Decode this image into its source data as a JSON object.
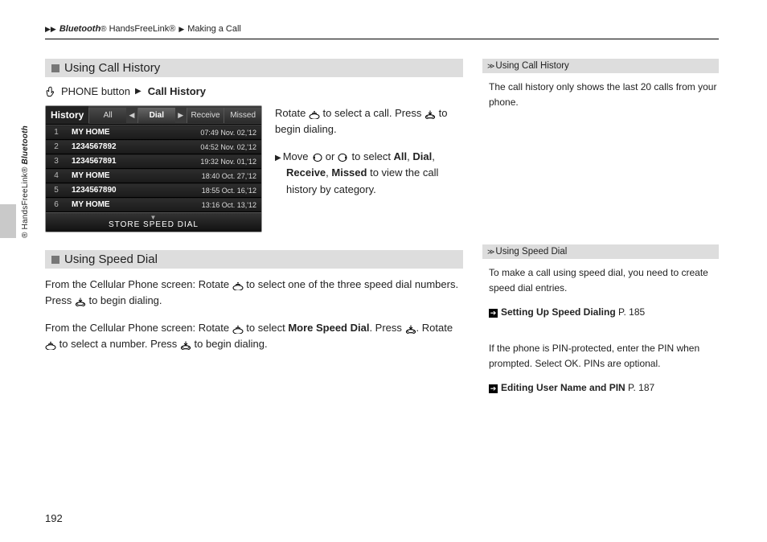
{
  "breadcrumb": {
    "seg1": "Bluetooth",
    "seg1reg": "®",
    "seg2": " HandsFreeLink®",
    "seg3": "Making a Call"
  },
  "side_vertical": {
    "t1": "Bluetooth",
    "t2": "® HandsFreeLink®"
  },
  "page_number": "192",
  "section1": {
    "title": "Using Call History",
    "step_prefix": "PHONE button",
    "step_link": "Call History",
    "rotate_text": "Rotate ",
    "rotate_text2": " to select a call. Press ",
    "rotate_text3": " to begin dialing.",
    "move_text1": "Move ",
    "move_text2": " or ",
    "move_text3": " to select ",
    "move_opts": {
      "all": "All",
      "dial": "Dial",
      "receive": "Receive",
      "missed": "Missed"
    },
    "move_text4": " to view the call history by category.",
    "sep": ", "
  },
  "screenshot": {
    "label": "History",
    "tabs": [
      "All",
      "Dial",
      "Receive",
      "Missed"
    ],
    "active_tab": 1,
    "rows": [
      {
        "n": "1",
        "name": "MY HOME",
        "ts": "07:49 Nov. 02,'12"
      },
      {
        "n": "2",
        "name": "1234567892",
        "ts": "04:52 Nov. 02,'12"
      },
      {
        "n": "3",
        "name": "1234567891",
        "ts": "19:32 Nov. 01,'12"
      },
      {
        "n": "4",
        "name": "MY HOME",
        "ts": "18:40 Oct. 27,'12"
      },
      {
        "n": "5",
        "name": "1234567890",
        "ts": "18:55 Oct. 16,'12"
      },
      {
        "n": "6",
        "name": "MY HOME",
        "ts": "13:16 Oct. 13,'12"
      }
    ],
    "footer": "STORE SPEED DIAL"
  },
  "section2": {
    "title": "Using Speed Dial",
    "p1a": "From the Cellular Phone screen: Rotate ",
    "p1b": " to select one of the three speed dial numbers. Press ",
    "p1c": " to begin dialing.",
    "p2a": "From the Cellular Phone screen: Rotate ",
    "p2b": " to select ",
    "p2bold": "More Speed Dial",
    "p2c": ". Press ",
    "p2d": ". Rotate ",
    "p2e": " to select a number. Press ",
    "p2f": " to begin dialing."
  },
  "sidebar": {
    "note1": {
      "title": "Using Call History",
      "body": "The call history only shows the last 20 calls from your phone."
    },
    "note2": {
      "title": "Using Speed Dial",
      "body1": "To make a call using speed dial, you need to create speed dial entries.",
      "xref1": "Setting Up Speed Dialing",
      "xref1p": " P. 185",
      "body2a": "If the phone is PIN-protected, enter the PIN when prompted. Select ",
      "body2ok": "OK",
      "body2b": ". PINs are optional.",
      "xref2": "Editing User Name and PIN",
      "xref2p": " P. 187"
    }
  }
}
